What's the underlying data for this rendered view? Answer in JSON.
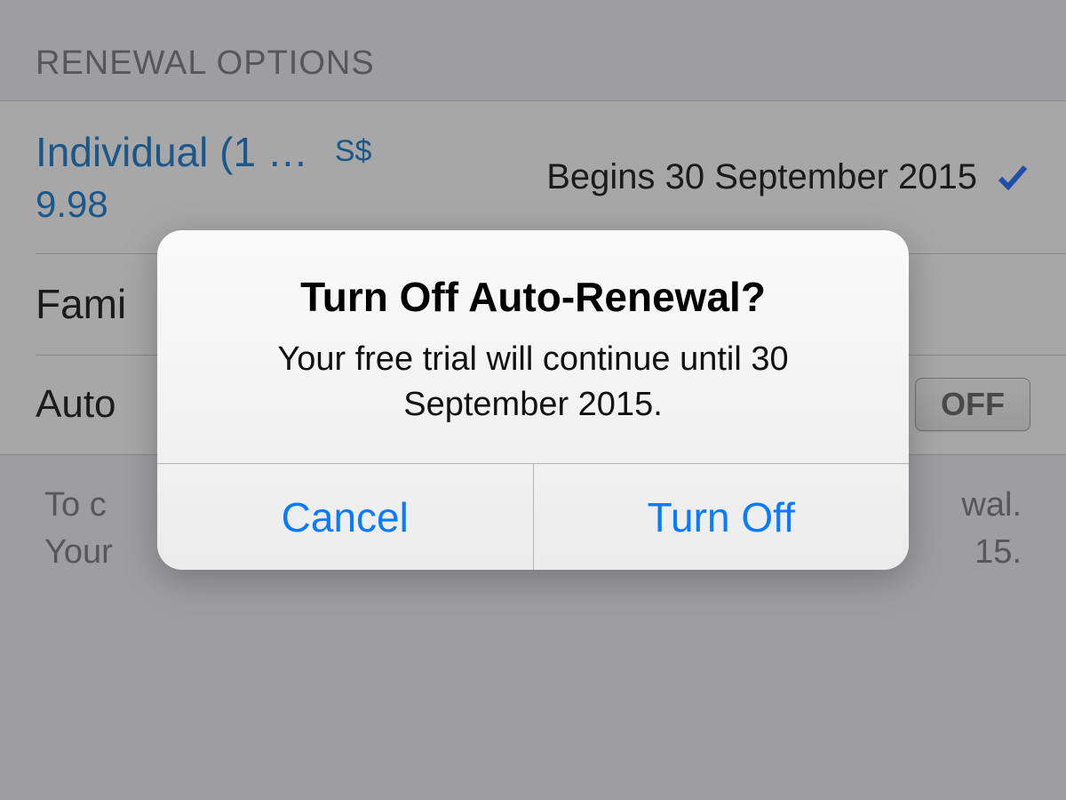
{
  "section_header": "RENEWAL OPTIONS",
  "plans": {
    "individual": {
      "name": "Individual (1 …",
      "currency": "S$",
      "price": "9.98",
      "begins_label": "Begins 30 September 2015",
      "selected": true
    },
    "family": {
      "name": "Fami"
    }
  },
  "auto_row": {
    "label_visible": "Auto",
    "toggle_state": "OFF"
  },
  "footer_left": "To c",
  "footer_left2": "Your",
  "footer_right": "wal.",
  "footer_right2": "15.",
  "alert": {
    "title": "Turn Off Auto-Renewal?",
    "message": "Your free trial will continue until 30 September 2015.",
    "cancel": "Cancel",
    "confirm": "Turn Off"
  }
}
